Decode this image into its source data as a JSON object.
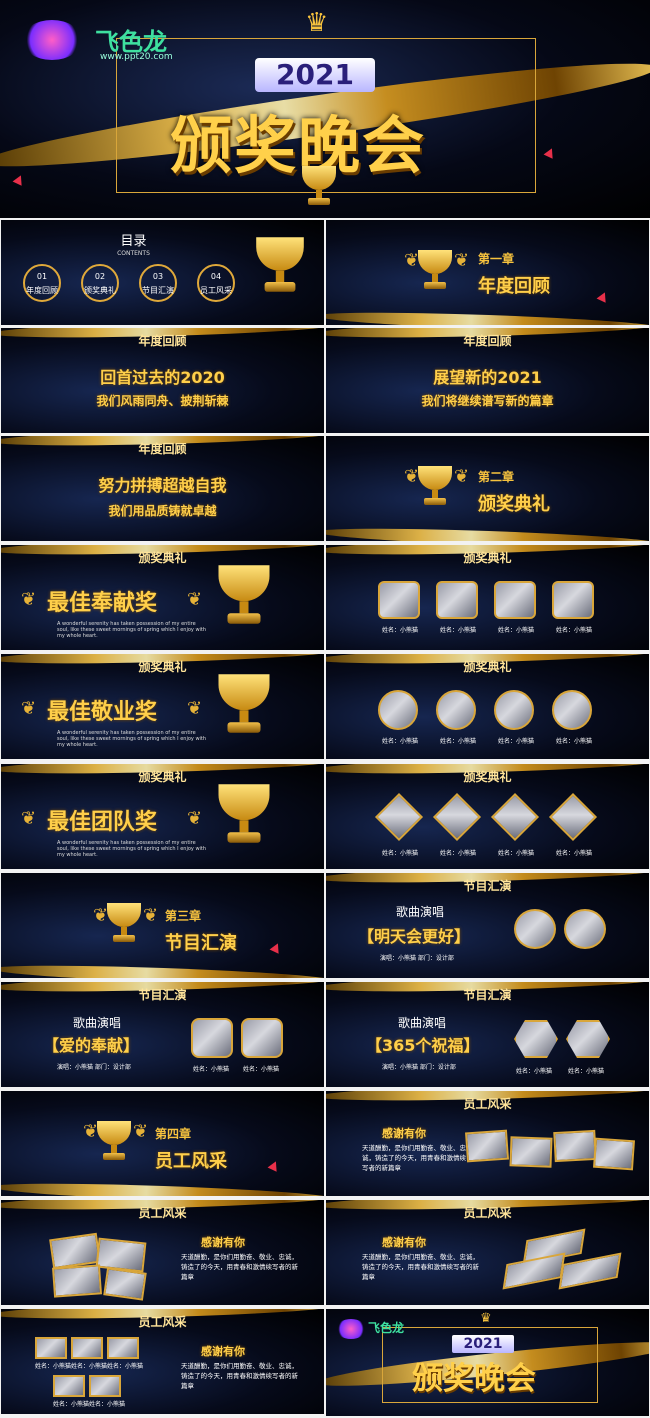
{
  "logo": {
    "text": "figure-logo 飞色龙 ppt20.com",
    "name": "飞色龙",
    "url": "www.ppt20.com"
  },
  "cover": {
    "year": "2021",
    "title": "颁奖晚会"
  },
  "toc": {
    "title": "目录",
    "subtitle": "CONTENTS",
    "items": [
      {
        "num": "01",
        "label": "年度回顾"
      },
      {
        "num": "02",
        "label": "颁奖典礼"
      },
      {
        "num": "03",
        "label": "节目汇演"
      },
      {
        "num": "04",
        "label": "员工风采"
      }
    ]
  },
  "ch1": {
    "chapter": "第一章",
    "title": "年度回顾"
  },
  "review1": {
    "header": "年度回顾",
    "line1": "回首过去的2020",
    "line2": "我们风雨同舟、披荆斩棘"
  },
  "review2": {
    "header": "年度回顾",
    "line1": "展望新的2021",
    "line2": "我们将继续谱写新的篇章"
  },
  "review3": {
    "header": "年度回顾",
    "line1": "努力拼搏超越自我",
    "line2": "我们用品质铸就卓越"
  },
  "ch2": {
    "chapter": "第二章",
    "title": "颁奖典礼"
  },
  "award1": {
    "header": "颁奖典礼",
    "title": "最佳奉献奖",
    "desc": "A wonderful serenity has taken possession of my entire soul, like these sweet mornings of spring which I enjoy with my whole heart."
  },
  "award2": {
    "header": "颁奖典礼",
    "title": "最佳敬业奖",
    "desc": "A wonderful serenity has taken possession of my entire soul, like these sweet mornings of spring which I enjoy with my whole heart."
  },
  "award3": {
    "header": "颁奖典礼",
    "title": "最佳团队奖",
    "desc": "A wonderful serenity has taken possession of my entire soul, like these sweet mornings of spring which I enjoy with my whole heart."
  },
  "winners": {
    "header": "颁奖典礼",
    "caption": "姓名：小熊猫"
  },
  "ch3": {
    "chapter": "第三章",
    "title": "节目汇演"
  },
  "show1": {
    "header": "节目汇演",
    "kind": "歌曲演唱",
    "song": "【明天会更好】",
    "info": "演唱：小熊猫  部门：设计部"
  },
  "show2": {
    "header": "节目汇演",
    "kind": "歌曲演唱",
    "song": "【爱的奉献】",
    "info": "演唱：小熊猫  部门：设计部",
    "caption": "姓名：小熊猫"
  },
  "show3": {
    "header": "节目汇演",
    "kind": "歌曲演唱",
    "song": "【365个祝福】",
    "info": "演唱：小熊猫  部门：设计部",
    "caption": "姓名：小熊猫"
  },
  "ch4": {
    "chapter": "第四章",
    "title": "员工风采"
  },
  "staff": {
    "header": "员工风采",
    "thanks": "感谢有你",
    "text": "天道酬勤，是你们用勤奋、敬业、忠诚，铸造了的今天，用青春和激情续写者的新篇章",
    "caption": "姓名：小熊猫"
  },
  "colors": {
    "gold": "#f6c23e",
    "bg": "#060a1a",
    "accent": "#e8304a"
  }
}
